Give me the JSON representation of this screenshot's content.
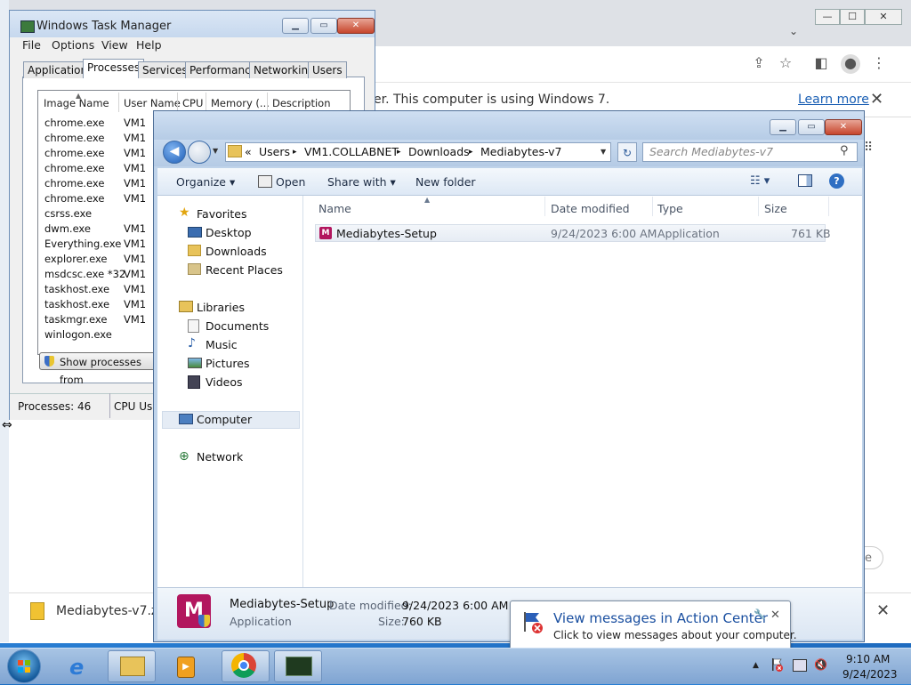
{
  "chrome": {
    "infobar_text": "er. This computer is using Windows 7.",
    "learn_more": "Learn more",
    "close": "✕",
    "pill_text": "e",
    "download_file": "Mediabytes-v7.zip",
    "download_close": "✕",
    "minimize": "—",
    "maximize": "☐",
    "window_close": "✕"
  },
  "taskmgr": {
    "title": "Windows Task Manager",
    "menu": [
      "File",
      "Options",
      "View",
      "Help"
    ],
    "tabs": [
      "Applications",
      "Processes",
      "Services",
      "Performance",
      "Networking",
      "Users"
    ],
    "active_tab": "Processes",
    "columns": [
      "Image Name",
      "User Name",
      "CPU",
      "Memory (...",
      "Description"
    ],
    "rows": [
      {
        "name": "chrome.exe",
        "user": "VM1"
      },
      {
        "name": "chrome.exe",
        "user": "VM1"
      },
      {
        "name": "chrome.exe",
        "user": "VM1"
      },
      {
        "name": "chrome.exe",
        "user": "VM1"
      },
      {
        "name": "chrome.exe",
        "user": "VM1"
      },
      {
        "name": "chrome.exe",
        "user": "VM1"
      },
      {
        "name": "csrss.exe",
        "user": ""
      },
      {
        "name": "dwm.exe",
        "user": "VM1"
      },
      {
        "name": "Everything.exe",
        "user": "VM1"
      },
      {
        "name": "explorer.exe",
        "user": "VM1"
      },
      {
        "name": "msdcsc.exe *32",
        "user": "VM1"
      },
      {
        "name": "taskhost.exe",
        "user": "VM1"
      },
      {
        "name": "taskhost.exe",
        "user": "VM1"
      },
      {
        "name": "taskmgr.exe",
        "user": "VM1"
      },
      {
        "name": "winlogon.exe",
        "user": ""
      }
    ],
    "show_processes_button": "Show processes from",
    "status_processes": "Processes: 46",
    "status_cpu": "CPU Usa"
  },
  "explorer": {
    "breadcrumbs": [
      "«",
      "Users",
      "▸",
      "VM1.COLLABNET",
      "▸",
      "Downloads",
      "▸",
      "Mediabytes-v7"
    ],
    "search_placeholder": "Search Mediabytes-v7",
    "toolbar": {
      "organize": "Organize ▾",
      "open": "Open",
      "share_with": "Share with ▾",
      "new_folder": "New folder"
    },
    "nav": {
      "favorites": "Favorites",
      "desktop": "Desktop",
      "downloads": "Downloads",
      "recent_places": "Recent Places",
      "libraries": "Libraries",
      "documents": "Documents",
      "music": "Music",
      "pictures": "Pictures",
      "videos": "Videos",
      "computer": "Computer",
      "network": "Network"
    },
    "columns": {
      "name": "Name",
      "date": "Date modified",
      "type": "Type",
      "size": "Size"
    },
    "files": [
      {
        "name": "Mediabytes-Setup",
        "date": "9/24/2023 6:00 AM",
        "type": "Application",
        "size": "761 KB"
      }
    ],
    "details": {
      "name": "Mediabytes-Setup",
      "date_label": "Date modified:",
      "date_value": "9/24/2023 6:00 AM",
      "type": "Application",
      "size_label": "Size:",
      "size_value": "760 KB",
      "icon_letter": "M"
    }
  },
  "action_center": {
    "title": "View messages in Action Center",
    "subtitle": "Click to view messages about your computer.",
    "close": "✕"
  },
  "taskbar": {
    "time": "9:10 AM",
    "date": "9/24/2023",
    "tray_arrow": "▲"
  }
}
